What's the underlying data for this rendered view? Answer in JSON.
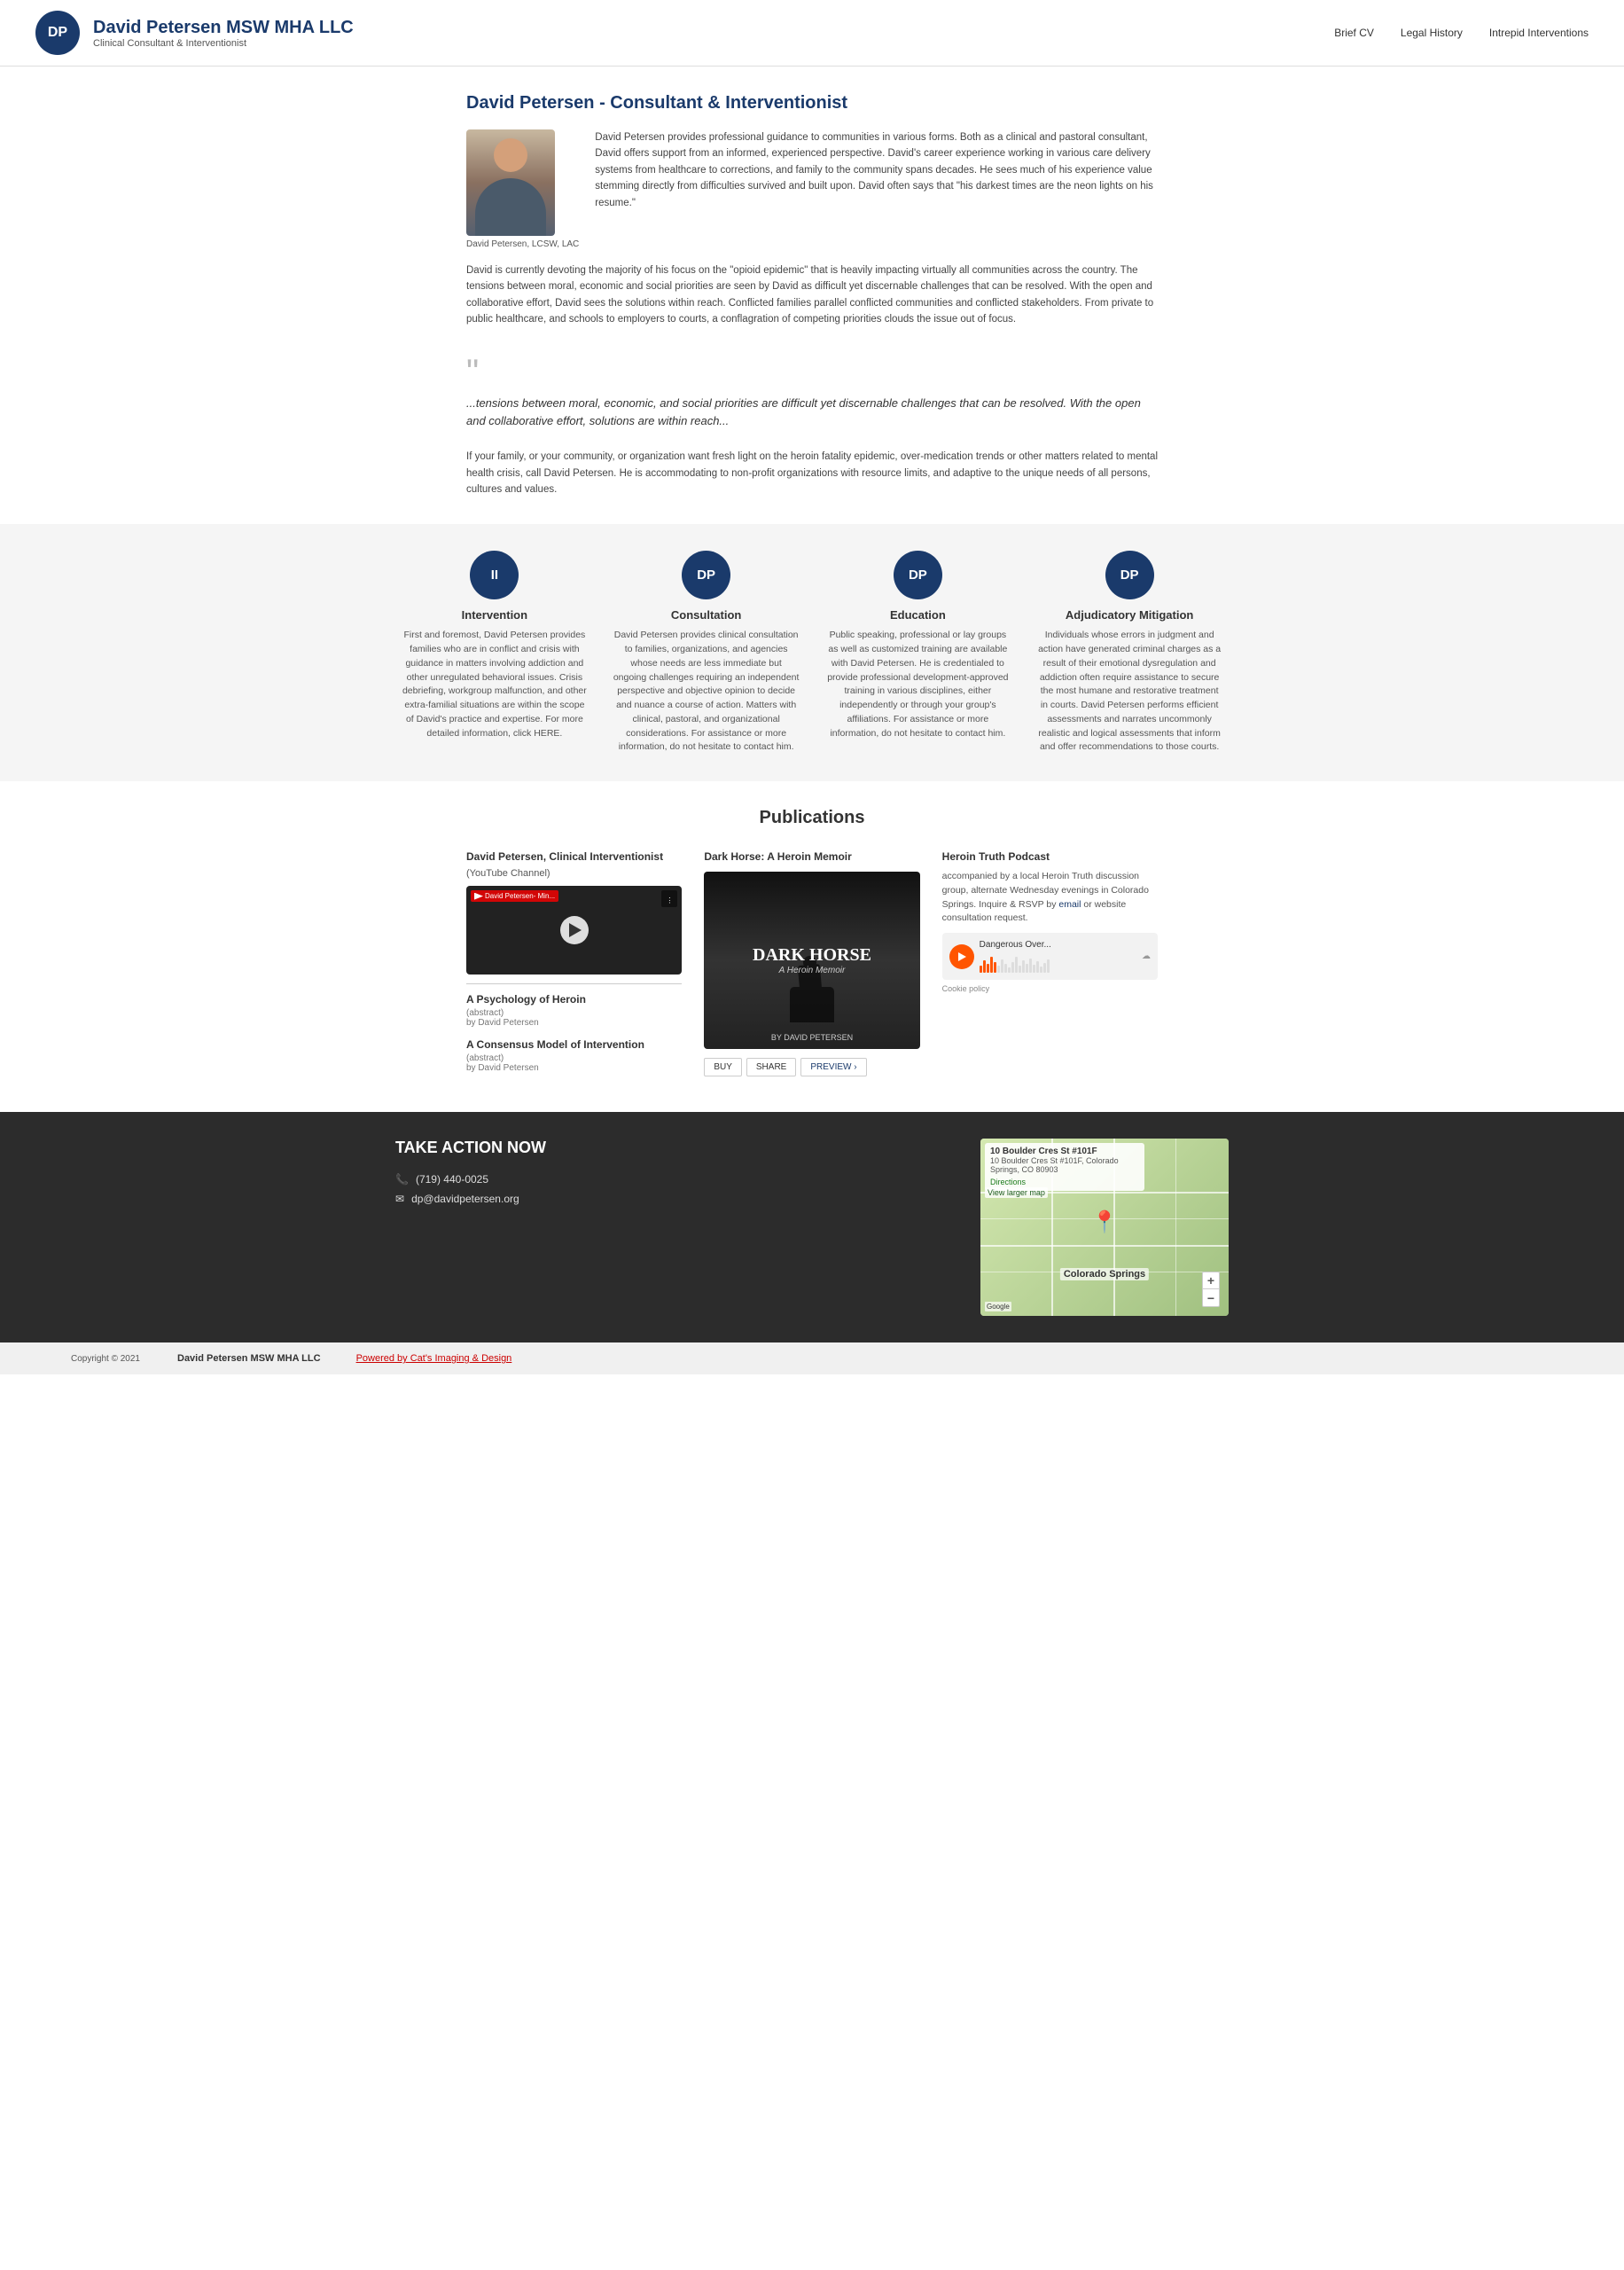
{
  "header": {
    "logo_text": "DP",
    "name": "David Petersen MSW MHA LLC",
    "subtitle": "Clinical Consultant & Interventionist",
    "nav": [
      {
        "label": "Brief CV",
        "id": "nav-brief-cv"
      },
      {
        "label": "Legal History",
        "id": "nav-legal-history"
      },
      {
        "label": "Intrepid Interventions",
        "id": "nav-intrepid"
      }
    ]
  },
  "hero": {
    "title": "David Petersen - Consultant & Interventionist",
    "img_caption": "David Petersen, LCSW, LAC",
    "intro_text": "David Petersen provides professional guidance to communities in various forms. Both as a clinical and pastoral consultant, David offers support from an informed, experienced perspective. David's career experience working in various care delivery systems from healthcare to corrections, and family to the community spans decades. He sees much of his experience value stemming directly from difficulties survived and built upon. David often says that \"his darkest times are the neon lights on his resume.\"",
    "body1": "David is currently devoting the majority of his focus on the \"opioid epidemic\" that is heavily impacting virtually all communities across the country. The tensions between moral, economic and social priorities are seen by David as difficult yet discernable challenges that can be resolved. With the open and collaborative effort, David sees the solutions within reach. Conflicted families parallel conflicted communities and conflicted stakeholders. From private to public healthcare, and schools to employers to courts, a conflagration of competing priorities clouds the issue out of focus.",
    "quote": "...tensions between moral, economic, and social priorities are difficult yet discernable challenges that can be resolved. With the open and collaborative effort, solutions are within reach...",
    "body2": "If your family, or your community, or organization want fresh light on the heroin fatality epidemic, over-medication trends or other matters related to mental health crisis, call David Petersen. He is accommodating to non-profit organizations with resource limits, and adaptive to the unique needs of all persons, cultures and values."
  },
  "services": [
    {
      "icon": "II",
      "title": "Intervention",
      "text": "First and foremost, David Petersen provides families who are in conflict and crisis with guidance in matters involving addiction and other unregulated behavioral issues. Crisis debriefing, workgroup malfunction, and other extra-familial situations are within the scope of David's practice and expertise. For more detailed information, click HERE."
    },
    {
      "icon": "DP",
      "title": "Consultation",
      "text": "David Petersen provides clinical consultation to families, organizations, and agencies whose needs are less immediate but ongoing challenges requiring an independent perspective and objective opinion to decide and nuance a course of action. Matters with clinical, pastoral, and organizational considerations. For assistance or more information, do not hesitate to contact him."
    },
    {
      "icon": "DP",
      "title": "Education",
      "text": "Public speaking, professional or lay groups as well as customized training are available with David Petersen. He is credentialed to provide professional development-approved training in various disciplines, either independently or through your group's affiliations. For assistance or more information, do not hesitate to contact him."
    },
    {
      "icon": "DP",
      "title": "Adjudicatory Mitigation",
      "text": "Individuals whose errors in judgment and action have generated criminal charges as a result of their emotional dysregulation and addiction often require assistance to secure the most humane and restorative treatment in courts. David Petersen performs efficient assessments and narrates uncommonly realistic and logical assessments that inform and offer recommendations to those courts."
    }
  ],
  "publications": {
    "section_title": "Publications",
    "col1": {
      "title": "David Petersen, Clinical Interventionist",
      "sub": "(YouTube Channel)",
      "video_label": "David Petersen- Min...",
      "item1_title": "A Psychology of Heroin",
      "item1_sub": "(abstract)\nby David Petersen",
      "item2_title": "A Consensus Model of Intervention",
      "item2_sub": "(abstract)\nby David Petersen"
    },
    "col2": {
      "title": "Dark Horse: A Heroin Memoir",
      "book_title": "DARK HORSE",
      "book_subtitle": "A Heroin Memoir",
      "book_author": "BY DAVID PETERSEN",
      "btn_buy": "BUY",
      "btn_share": "SHARE",
      "btn_preview": "PREVIEW ›"
    },
    "col3": {
      "title": "Heroin Truth Podcast",
      "text1": "accompanied by a local Heroin Truth discussion group, alternate Wednesday evenings in Colorado Springs. Inquire & RSVP by ",
      "link_text": "email",
      "text2": " or website consultation request.",
      "sc_title": "Dangerous Over...",
      "cookie_policy": "Cookie policy"
    }
  },
  "footer_cta": {
    "title": "TAKE ACTION NOW",
    "phone": "(719) 440-0025",
    "email": "dp@davidpetersen.org",
    "map_address_line1": "10 Boulder Cres St #101F",
    "map_address_line2": "10 Boulder Cres St #101F, Colorado Springs, CO 80903",
    "map_link": "View larger map",
    "map_label": "Colorado Springs",
    "directions": "Directions"
  },
  "bottom_footer": {
    "copyright": "Copyright © 2021",
    "brand": "David Petersen MSW MHA LLC",
    "powered_by": "Powered by Cat's Imaging & Design"
  }
}
